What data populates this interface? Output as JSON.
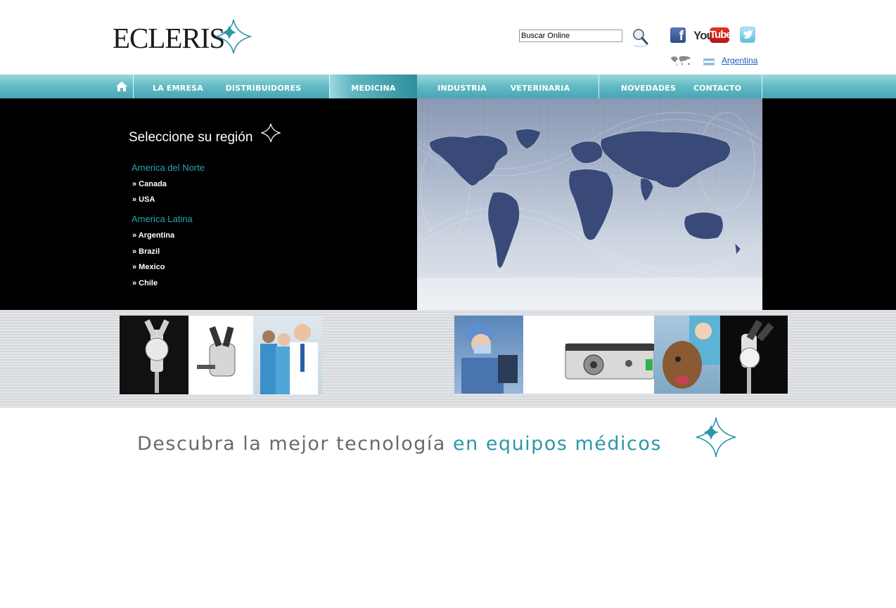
{
  "header": {
    "logo_text": "ECLERIS",
    "search_placeholder": "Buscar Online",
    "social": [
      "facebook",
      "youtube",
      "twitter"
    ],
    "youtube_label_you": "You",
    "youtube_label_tube": "Tube",
    "country_label": "Argentina"
  },
  "nav": {
    "items": [
      {
        "label": "LA EMRESA"
      },
      {
        "label": "DISTRIBUIDORES"
      },
      {
        "label": "MEDICINA",
        "active": true
      },
      {
        "label": "INDUSTRIA"
      },
      {
        "label": "VETERINARIA"
      },
      {
        "label": "NOVEDADES"
      },
      {
        "label": "CONTACTO"
      }
    ]
  },
  "region": {
    "title": "Seleccione su región",
    "groups": [
      {
        "heading": "America del Norte",
        "links": [
          "» Canada",
          "» USA"
        ]
      },
      {
        "heading": "America Latina",
        "links": [
          "» Argentina",
          "» Brazil",
          "» Mexico",
          "» Chile"
        ]
      }
    ]
  },
  "tagline": {
    "part1": "Descubra la mejor tecnología ",
    "part2": "en equipos médicos"
  },
  "colors": {
    "accent": "#2aa4b7",
    "nav_top": "#9cd8dd",
    "nav_bottom": "#45a6b3",
    "link": "#1a5fc8"
  }
}
